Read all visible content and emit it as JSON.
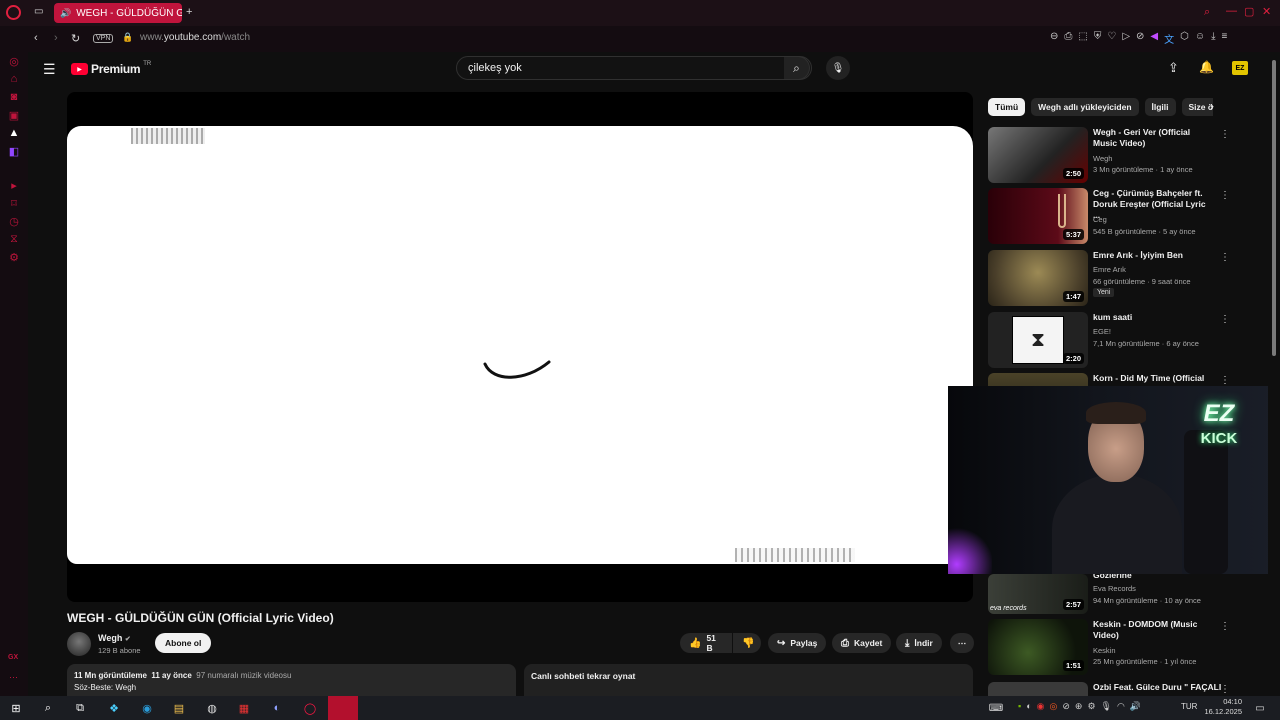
{
  "browser": {
    "tab_title": "WEGH - GÜLDÜĞÜN G",
    "url_prefix": "www.",
    "url_host": "youtube.com",
    "url_path": "/watch",
    "vpn_label": "VPN"
  },
  "youtube": {
    "logo_text": "Premium",
    "logo_sup": "TR",
    "search_value": "çilekeş yok"
  },
  "video": {
    "title": "WEGH - GÜLDÜĞÜN GÜN (Official Lyric Video)",
    "channel": "Wegh",
    "subscribers": "129 B abone",
    "subscribe_label": "Abone ol",
    "likes": "51 B",
    "share_label": "Paylaş",
    "save_label": "Kaydet",
    "download_label": "İndir",
    "views": "11 Mn görüntüleme",
    "age": "11 ay önce",
    "chart_rank": "97 numaralı müzik videosu",
    "credits": "Söz-Beste: Wegh",
    "live_chat_replay": "Canlı sohbeti tekrar oynat"
  },
  "chips": [
    "Tümü",
    "Wegh adlı yükleyiciden",
    "İlgili",
    "Size ö"
  ],
  "recommendations": [
    {
      "title": "Wegh - Geri Ver (Official Music Video)",
      "channel": "Wegh",
      "meta": "3 Mn görüntüleme · 1 ay önce",
      "duration": "2:50",
      "thumb_color": "#3a3a3a"
    },
    {
      "title": "Ceg - Çürümüş Bahçeler ft. Doruk Ereşter (Official Lyric ...",
      "channel": "Ceg",
      "meta": "545 B görüntüleme · 5 ay önce",
      "duration": "5:37",
      "thumb_color": "#3a0a12"
    },
    {
      "title": "Emre Arık - İyiyim Ben",
      "channel": "Emre Arık",
      "meta": "66 görüntüleme · 9 saat önce",
      "badge": "Yeni",
      "duration": "1:47",
      "thumb_color": "#6b5a3a"
    },
    {
      "title": "kum saati",
      "channel": "EGE!",
      "meta": "7,1 Mn görüntüleme · 6 ay önce",
      "duration": "2:20",
      "thumb_color": "#e8e8e8"
    },
    {
      "title": "Korn - Did My Time (Official",
      "channel": "",
      "meta": "",
      "duration": "",
      "thumb_color": "#2a2a20"
    },
    {
      "title": "Gözlerine",
      "channel": "Eva Records",
      "meta": "94 Mn görüntüleme · 10 ay önce",
      "duration": "2:57",
      "thumb_color": "#2b2f2a",
      "thumb_caption": "eva records"
    },
    {
      "title": "Keskin - DOMDOM (Music Video)",
      "channel": "Keskin",
      "meta": "25 Mn görüntüleme · 1 yıl önce",
      "duration": "1:51",
      "thumb_color": "#1e2a18"
    },
    {
      "title": "Ozbi Feat. Gülce Duru \" FAÇALI",
      "channel": "",
      "meta": "",
      "duration": "",
      "thumb_color": "#333"
    }
  ],
  "webcam": {
    "sign_line1": "EZ",
    "sign_line2": "KICK"
  },
  "taskbar": {
    "language": "TUR",
    "time": "04:10",
    "date": "16.12.2025"
  },
  "colors": {
    "accent": "#c0143c",
    "yt_red": "#ff0033",
    "neon": "#7dffb0"
  }
}
